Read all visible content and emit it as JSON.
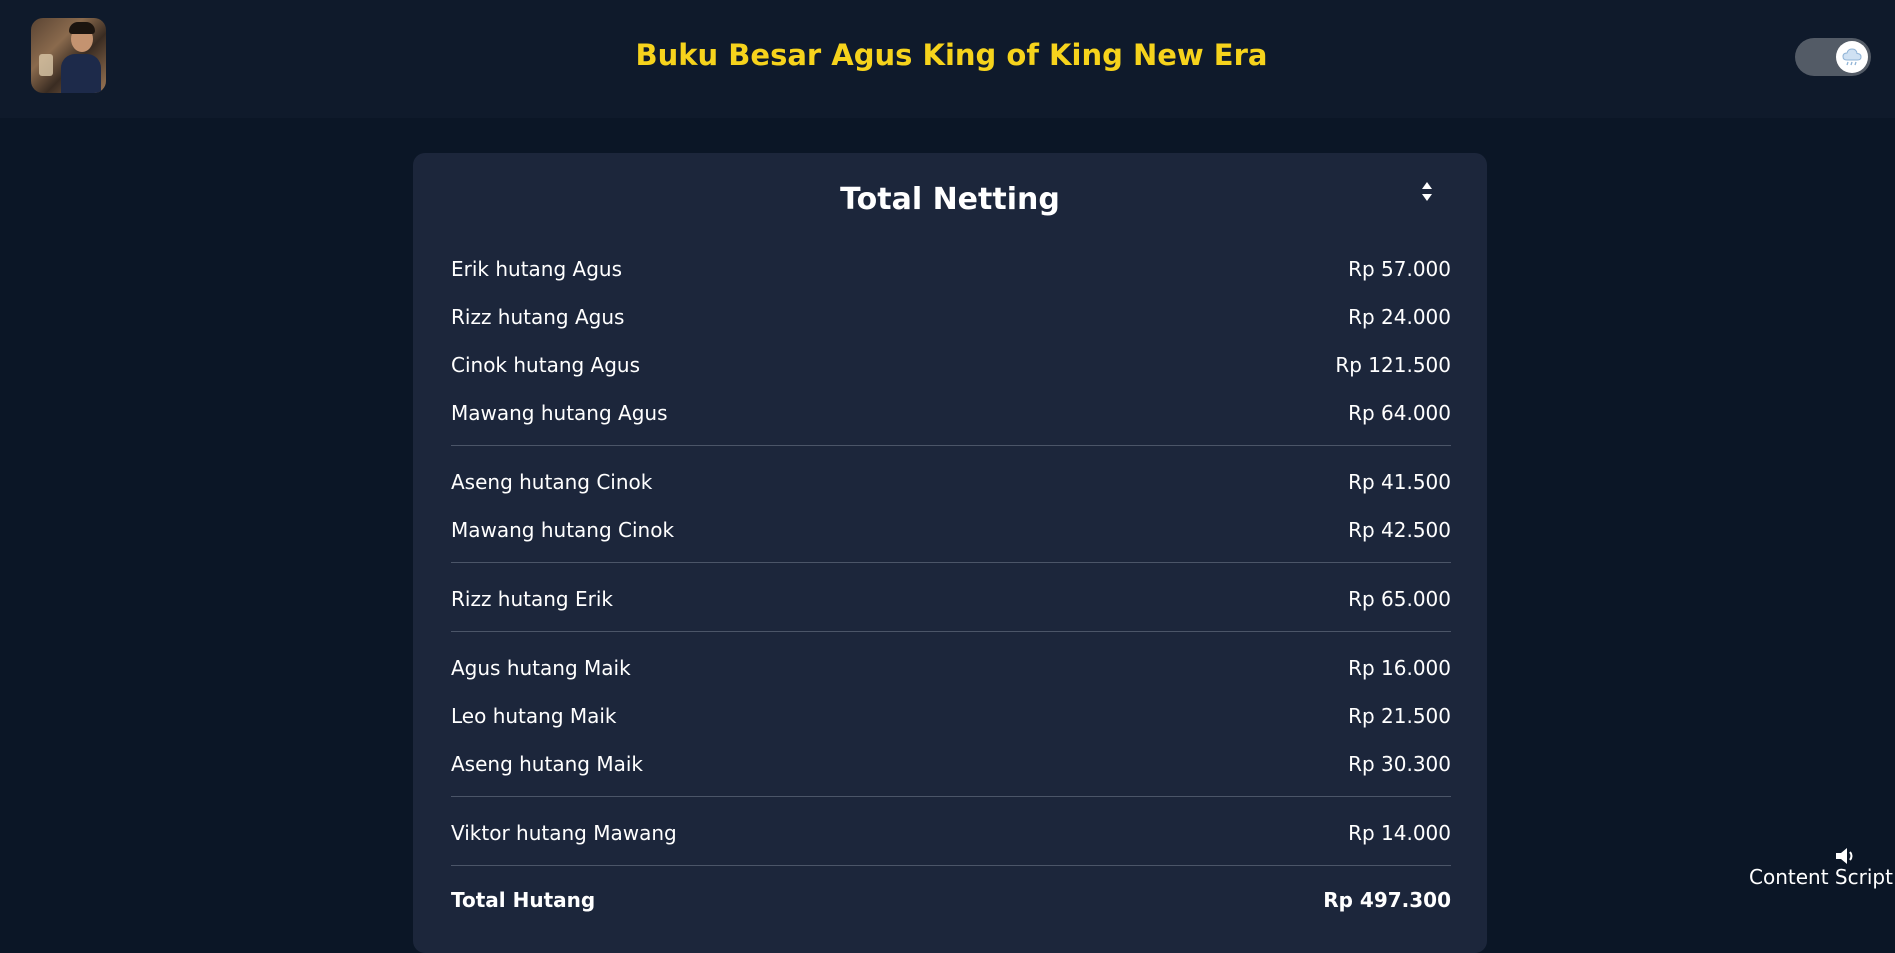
{
  "header": {
    "title": "Buku Besar Agus King of King New Era",
    "avatar_icon": "user-photo",
    "theme_toggle_icon": "cloud-icon"
  },
  "card": {
    "title": "Total Netting",
    "sort_icon": "sort-updown-icon",
    "groups": [
      [
        {
          "name": "Erik hutang Agus",
          "amount": "Rp 57.000"
        },
        {
          "name": "Rizz hutang Agus",
          "amount": "Rp 24.000"
        },
        {
          "name": "Cinok hutang Agus",
          "amount": "Rp 121.500"
        },
        {
          "name": "Mawang hutang Agus",
          "amount": "Rp 64.000"
        }
      ],
      [
        {
          "name": "Aseng hutang Cinok",
          "amount": "Rp 41.500"
        },
        {
          "name": "Mawang hutang Cinok",
          "amount": "Rp 42.500"
        }
      ],
      [
        {
          "name": "Rizz hutang Erik",
          "amount": "Rp 65.000"
        }
      ],
      [
        {
          "name": "Agus hutang Maik",
          "amount": "Rp 16.000"
        },
        {
          "name": "Leo hutang Maik",
          "amount": "Rp 21.500"
        },
        {
          "name": "Aseng hutang Maik",
          "amount": "Rp 30.300"
        }
      ],
      [
        {
          "name": "Viktor hutang Mawang",
          "amount": "Rp 14.000"
        }
      ]
    ],
    "total": {
      "name": "Total Hutang",
      "amount": "Rp 497.300"
    }
  },
  "widget": {
    "label": "Content Script",
    "icon": "speaker-icon"
  },
  "colors": {
    "background": "#0b1626",
    "header": "#0f1a2b",
    "title_accent": "#f6d31c",
    "card": "#1c263b",
    "divider": "#4b5568"
  }
}
